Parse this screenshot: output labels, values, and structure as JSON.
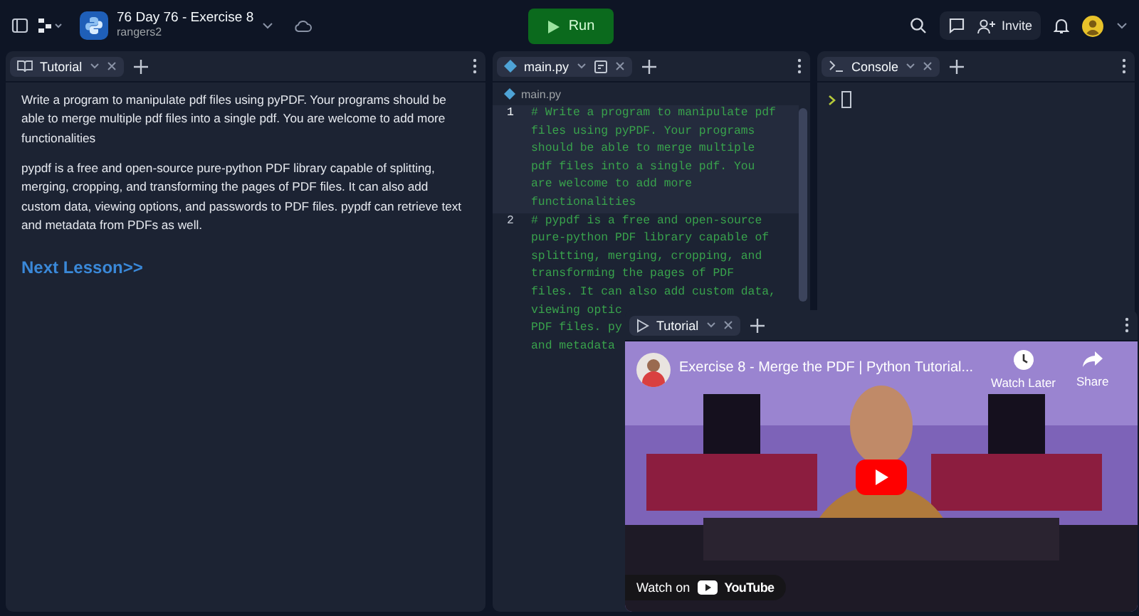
{
  "topbar": {
    "project_title": "76 Day 76 - Exercise 8",
    "owner": "rangers2",
    "run_label": "Run",
    "invite_label": "Invite"
  },
  "tutorial": {
    "tabs": [
      {
        "label": "Tutorial",
        "kind": "book",
        "selected": true
      }
    ],
    "paragraphs": [
      "Write a program to manipulate pdf files using pyPDF. Your programs should be able to merge multiple pdf files into a single pdf. You are welcome to add more functionalities",
      "pypdf is a free and open-source pure-python PDF library capable of splitting, merging, cropping, and transforming the pages of PDF files. It can also add custom data, viewing options, and passwords to PDF files. pypdf can retrieve text and metadata from PDFs as well."
    ],
    "link": "Next Lesson>>"
  },
  "editor": {
    "tabs": [
      {
        "label": "main.py",
        "kind": "python",
        "selected": true
      }
    ],
    "file": "main.py",
    "lines": [
      {
        "number": "1",
        "active": true,
        "rows": [
          "# Write a program to manipulate pdf",
          "files using pyPDF. Your programs",
          "should be able to merge multiple",
          "pdf files into a single pdf. You",
          "are welcome to add more",
          "functionalities"
        ]
      },
      {
        "number": "2",
        "active": false,
        "rows": [
          "# pypdf is a free and open-source",
          "pure-python PDF library capable of",
          "splitting, merging, cropping, and",
          "transforming the pages of PDF",
          "files. It can also add custom data,",
          "viewing optic",
          "PDF files. py",
          "and metadata"
        ]
      }
    ]
  },
  "console": {
    "tabs": [
      {
        "label": "Console",
        "kind": "terminal",
        "selected": true
      }
    ]
  },
  "video_pane": {
    "tabs": [
      {
        "label": "Tutorial",
        "kind": "play",
        "selected": true
      }
    ],
    "title": "Exercise 8 - Merge the PDF | Python Tutorial...",
    "watch_later": "Watch Later",
    "share": "Share",
    "watch_on": "Watch on",
    "brand": "YouTube"
  }
}
